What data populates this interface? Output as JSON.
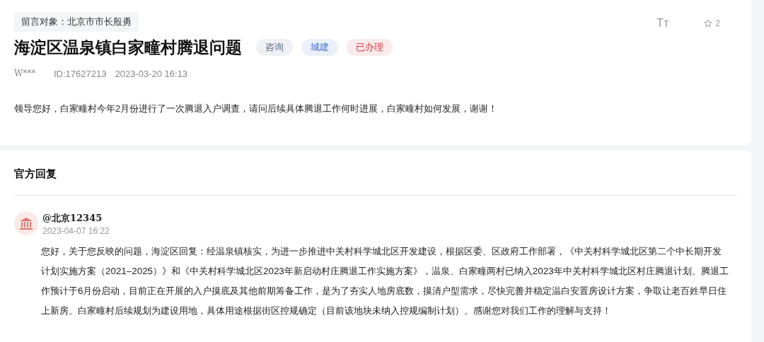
{
  "recipient": {
    "label": "留言对象：北京市市长殷勇"
  },
  "title": "海淀区温泉镇白家疃村腾退问题",
  "tags": [
    {
      "label": "咨询",
      "color": "#5a6b8a"
    },
    {
      "label": "城建",
      "color": "#3f6fd0"
    },
    {
      "label": "已办理",
      "color": "#d0343c"
    }
  ],
  "toolbar": {
    "font_size": "Tт",
    "favorites": "2"
  },
  "meta": {
    "author": "W***",
    "id": "ID:17627213",
    "time": "2023-03-20 16:13"
  },
  "message": "领导您好，白家疃村今年2月份进行了一次腾退入户调查，请问后续具体腾退工作何时进展，白家疃村如何发展，谢谢！",
  "reply_section": {
    "heading": "官方回复",
    "author": "@北京12345",
    "time": "2023-04-07 16:22",
    "body": "您好，关于您反映的问题，海淀区回复：经温泉镇核实，为进一步推进中关村科学城北区开发建设，根据区委、区政府工作部署，《中关村科学城北区第二个中长期开发计划实施方案（2021–2025）》和《中关村科学城北区2023年新启动村庄腾退工作实施方案》，温泉、白家疃两村已纳入2023年中关村科学城北区村庄腾退计划。腾退工作预计于6月份启动，目前正在开展的入户摸底及其他前期筹备工作，是为了夯实人地房底数，摸清户型需求，尽快完善并稳定温白安置房设计方案，争取让老百姓早日住上新房。白家疃村后续规划为建设用地，具体用途根据街区控规确定（目前该地块未纳入控规编制计划）。感谢您对我们工作的理解与支持！"
  }
}
